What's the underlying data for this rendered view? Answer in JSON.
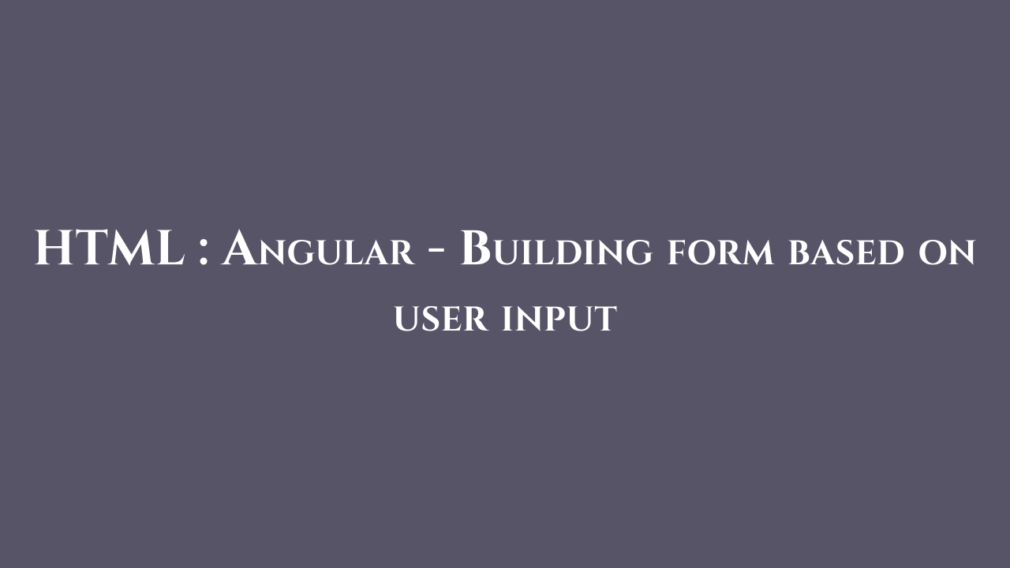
{
  "title": "HTML : Angular - Building form based on user input"
}
